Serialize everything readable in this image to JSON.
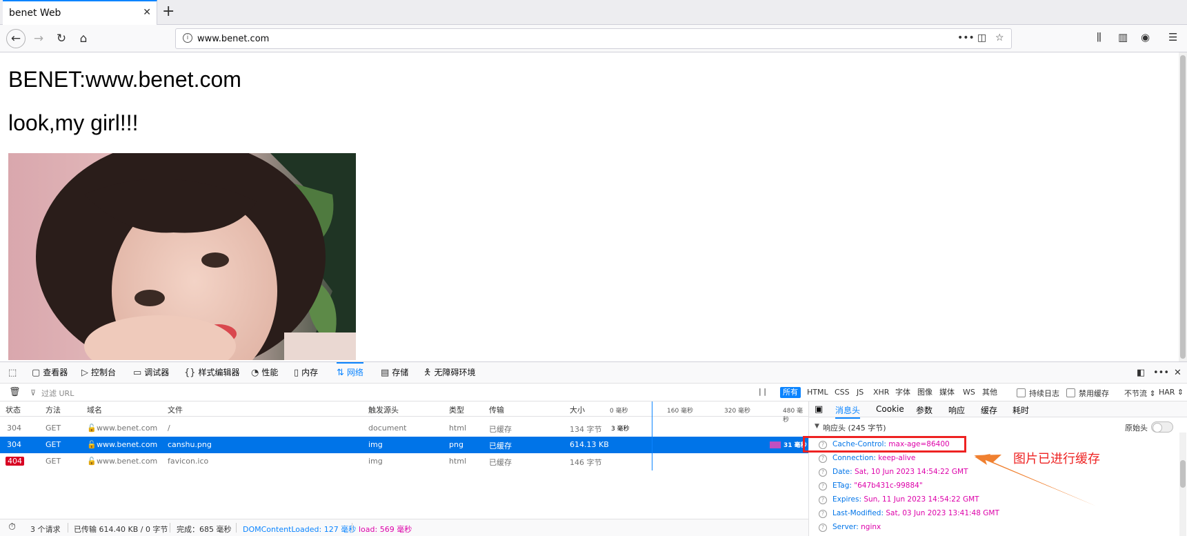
{
  "browser": {
    "tab_title": "benet Web",
    "url": "www.benet.com",
    "icons": [
      "back-icon",
      "forward-icon",
      "reload-icon",
      "home-icon",
      "info-icon",
      "more-icon",
      "pocket-icon",
      "star-icon",
      "library-icon",
      "sidebar-icon",
      "account-icon",
      "menu-icon"
    ]
  },
  "page": {
    "heading1": "BENET:www.benet.com",
    "heading2": "look,my girl!!!"
  },
  "devtools": {
    "tabs": [
      "查看器",
      "控制台",
      "调试器",
      "样式编辑器",
      "性能",
      "内存",
      "网络",
      "存储",
      "无障碍环境"
    ],
    "active_tab": "网络",
    "filter_placeholder": "过滤 URL",
    "filter_types": [
      "所有",
      "HTML",
      "CSS",
      "JS",
      "XHR",
      "字体",
      "图像",
      "媒体",
      "WS",
      "其他"
    ],
    "persist_log": "持续日志",
    "disable_cache": "禁用缓存",
    "throttle": "不节流 ⇕",
    "har": "HAR ⇕",
    "columns": [
      "状态",
      "方法",
      "域名",
      "文件",
      "触发源头",
      "类型",
      "传输",
      "大小"
    ],
    "waterfall_ticks": [
      "0 毫秒",
      "160 毫秒",
      "320 毫秒",
      "480 毫秒"
    ],
    "rows": [
      {
        "status": "304",
        "method": "GET",
        "domain": "www.benet.com",
        "file": "/",
        "cause": "document",
        "type": "html",
        "transferred": "已缓存",
        "size": "134 字节",
        "timing": "3 毫秒"
      },
      {
        "status": "304",
        "method": "GET",
        "domain": "www.benet.com",
        "file": "canshu.png",
        "cause": "img",
        "type": "png",
        "transferred": "已缓存",
        "size": "614.13 KB",
        "timing": "31 毫秒"
      },
      {
        "status": "404",
        "method": "GET",
        "domain": "www.benet.com",
        "file": "favicon.ico",
        "cause": "img",
        "type": "html",
        "transferred": "已缓存",
        "size": "146 字节",
        "timing": ""
      }
    ],
    "status_bar": {
      "requests": "3 个请求",
      "transferred": "已传输 614.40 KB / 0 字节",
      "finish": "完成：685 毫秒",
      "dcl": "DOMContentLoaded: 127 毫秒",
      "load": "load: 569 毫秒"
    },
    "side_tabs": [
      "消息头",
      "Cookie",
      "参数",
      "响应",
      "缓存",
      "耗时"
    ],
    "response_headers_title": "响应头 (245 字节)",
    "raw_headers": "原始头",
    "headers": [
      {
        "key": "Cache-Control:",
        "value": "max-age=86400"
      },
      {
        "key": "Connection:",
        "value": "keep-alive"
      },
      {
        "key": "Date:",
        "value": "Sat, 10 Jun 2023 14:54:22 GMT"
      },
      {
        "key": "ETag:",
        "value": "\"647b431c-99884\""
      },
      {
        "key": "Expires:",
        "value": "Sun, 11 Jun 2023 14:54:22 GMT"
      },
      {
        "key": "Last-Modified:",
        "value": "Sat, 03 Jun 2023 13:41:48 GMT"
      },
      {
        "key": "Server:",
        "value": "nginx"
      }
    ]
  },
  "annotation": {
    "text": "图片已进行缓存",
    "color": "#ee2222",
    "arrow_color": "#f08030"
  }
}
